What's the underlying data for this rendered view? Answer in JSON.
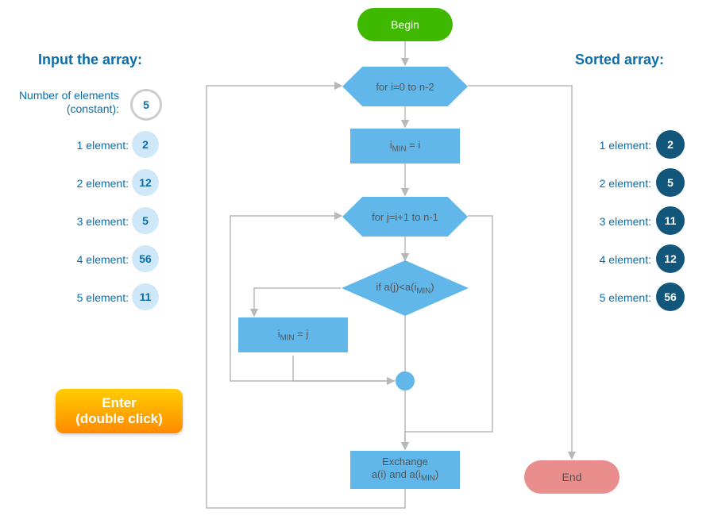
{
  "input": {
    "heading": "Input the array:",
    "n_label": "Number of elements (constant):",
    "n_value": "5",
    "items": [
      {
        "label": "1 element:",
        "value": "2"
      },
      {
        "label": "2 element:",
        "value": "12"
      },
      {
        "label": "3 element:",
        "value": "5"
      },
      {
        "label": "4 element:",
        "value": "56"
      },
      {
        "label": "5 element:",
        "value": "11"
      }
    ],
    "enter_line1": "Enter",
    "enter_line2": "(double click)"
  },
  "sorted": {
    "heading": "Sorted array:",
    "items": [
      {
        "label": "1 element:",
        "value": "2"
      },
      {
        "label": "2 element:",
        "value": "5"
      },
      {
        "label": "3 element:",
        "value": "11"
      },
      {
        "label": "4 element:",
        "value": "12"
      },
      {
        "label": "5 element:",
        "value": "56"
      }
    ]
  },
  "flow": {
    "begin": "Begin",
    "outer_loop": "for i=0 to n-2",
    "imin_i_a": "i",
    "imin_i_b": "MIN",
    "imin_i_c": " = i",
    "inner_loop": "for j=i+1 to n-1",
    "cond_a": "if a(j)<a(i",
    "cond_b": "MIN",
    "cond_c": ")",
    "imin_j_a": "i",
    "imin_j_b": "MIN",
    "imin_j_c": " = j",
    "xchg_l1": "Exchange",
    "xchg_l2a": "a(i) and a(i",
    "xchg_l2b": "MIN",
    "xchg_l2c": ")",
    "end": "End"
  },
  "chart_data": {
    "type": "flowchart",
    "nodes": [
      {
        "id": "begin",
        "shape": "terminator",
        "label": "Begin"
      },
      {
        "id": "outer_loop",
        "shape": "loop",
        "label": "for i=0 to n-2"
      },
      {
        "id": "imin_i",
        "shape": "process",
        "label": "i_MIN = i"
      },
      {
        "id": "inner_loop",
        "shape": "loop",
        "label": "for j=i+1 to n-1"
      },
      {
        "id": "cond",
        "shape": "decision",
        "label": "if a(j) < a(i_MIN)"
      },
      {
        "id": "imin_j",
        "shape": "process",
        "label": "i_MIN = j"
      },
      {
        "id": "junction",
        "shape": "connector",
        "label": ""
      },
      {
        "id": "exchange",
        "shape": "process",
        "label": "Exchange a(i) and a(i_MIN)"
      },
      {
        "id": "end",
        "shape": "terminator",
        "label": "End"
      }
    ],
    "edges": [
      {
        "from": "begin",
        "to": "outer_loop"
      },
      {
        "from": "outer_loop",
        "to": "imin_i",
        "note": "loop body"
      },
      {
        "from": "imin_i",
        "to": "inner_loop"
      },
      {
        "from": "inner_loop",
        "to": "cond",
        "note": "loop body"
      },
      {
        "from": "cond",
        "to": "imin_j",
        "condition": "true"
      },
      {
        "from": "cond",
        "to": "junction",
        "condition": "false"
      },
      {
        "from": "imin_j",
        "to": "junction"
      },
      {
        "from": "junction",
        "to": "inner_loop",
        "note": "next j"
      },
      {
        "from": "inner_loop",
        "to": "exchange",
        "note": "loop exit"
      },
      {
        "from": "exchange",
        "to": "outer_loop",
        "note": "next i"
      },
      {
        "from": "outer_loop",
        "to": "end",
        "note": "loop exit"
      }
    ]
  }
}
